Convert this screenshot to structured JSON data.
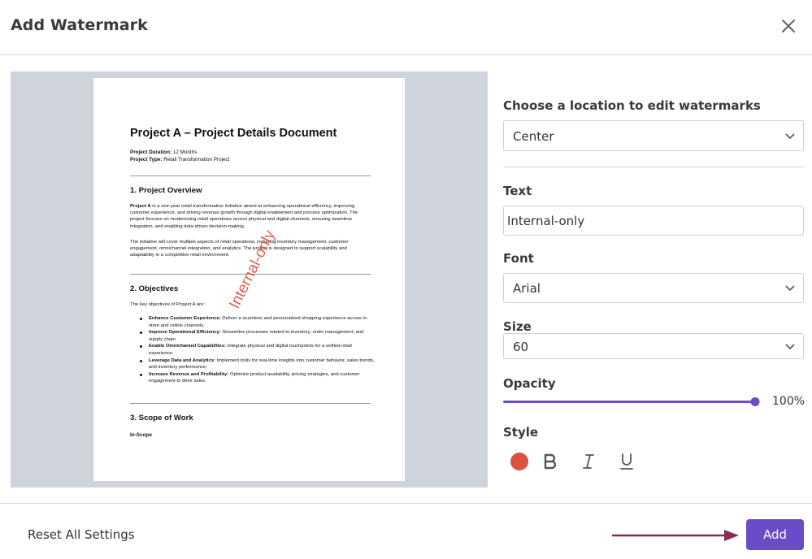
{
  "dialog": {
    "title": "Add Watermark"
  },
  "preview": {
    "doc_title": "Project A – Project Details Document",
    "duration_label": "Project Duration:",
    "duration_value": "12 Months",
    "type_label": "Project Type:",
    "type_value": "Retail Transformation Project",
    "section1_heading": "1. Project Overview",
    "section1_para1_lead": "Project A",
    "section1_para1": "is a one-year retail transformation initiative aimed at enhancing operational efficiency, improving customer experience, and driving revenue growth through digital enablement and process optimization. The project focuses on modernizing retail operations across physical and digital channels, ensuring seamless integration, and enabling data-driven decision-making.",
    "section1_para2": "The initiative will cover multiple aspects of retail operations, including inventory management, customer engagement, omnichannel integration, and analytics. The project is designed to support scalability and adaptability in a competitive retail environment.",
    "section2_heading": "2. Objectives",
    "section2_intro": "The key objectives of Project A are:",
    "objectives": [
      {
        "lead": "Enhance Customer Experience:",
        "text": "Deliver a seamless and personalized shopping experience across in-store and online channels."
      },
      {
        "lead": "Improve Operational Efficiency:",
        "text": "Streamline processes related to inventory, order management, and supply chain."
      },
      {
        "lead": "Enable Omnichannel Capabilities:",
        "text": "Integrate physical and digital touchpoints for a unified retail experience."
      },
      {
        "lead": "Leverage Data and Analytics:",
        "text": "Implement tools for real-time insights into customer behavior, sales trends, and inventory performance."
      },
      {
        "lead": "Increase Revenue and Profitability:",
        "text": "Optimize product availability, pricing strategies, and customer engagement to drive sales."
      }
    ],
    "section3_heading": "3. Scope of Work",
    "section3_sub": "In-Scope",
    "watermark_text": "Internal-only"
  },
  "settings": {
    "location_label": "Choose a location to edit watermarks",
    "location_value": "Center",
    "text_label": "Text",
    "text_value": "Internal-only",
    "font_label": "Font",
    "font_value": "Arial",
    "size_label": "Size",
    "size_value": "60",
    "opacity_label": "Opacity",
    "opacity_value": "100%",
    "opacity_fraction": 1.0,
    "style_label": "Style",
    "watermark_color": "#d9533f",
    "style_icons": [
      "bold-icon",
      "italic-icon",
      "underline-icon"
    ]
  },
  "footer": {
    "reset_label": "Reset All Settings",
    "add_label": "Add"
  },
  "colors": {
    "accent": "#6a4cc9",
    "annotation_arrow": "#8a2a55"
  }
}
